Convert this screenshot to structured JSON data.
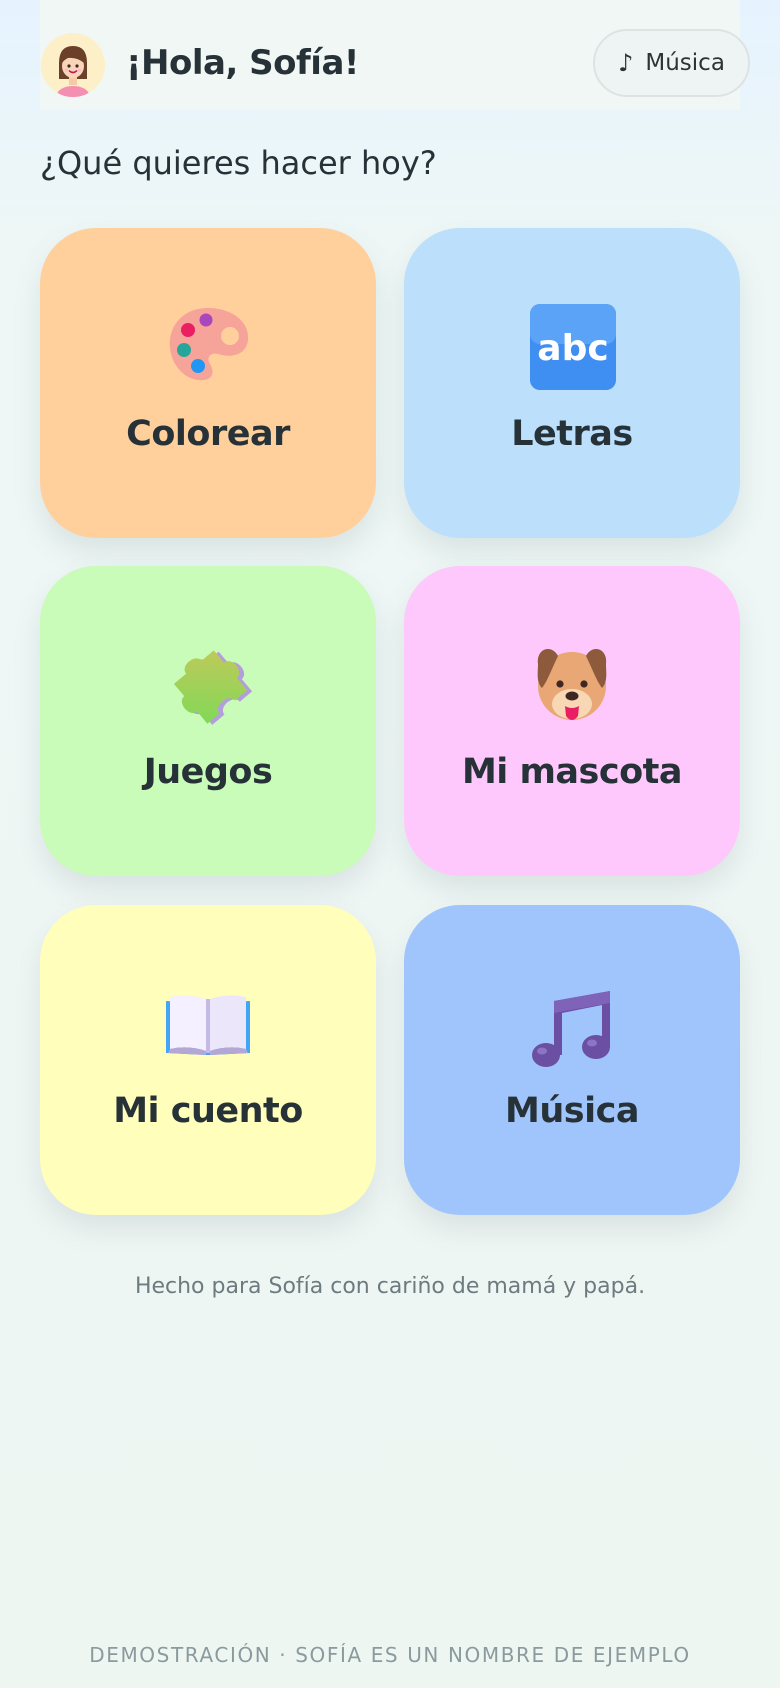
{
  "header": {
    "greeting": "¡Hola, Sofía!",
    "avatar_icon": "girl-avatar-icon",
    "music_button": {
      "icon": "music-note-icon",
      "glyph": "♪",
      "label": "Música"
    }
  },
  "subtitle": "¿Qué quieres hacer hoy?",
  "tiles": [
    {
      "label": "Colorear",
      "icon": "palette-icon",
      "color": "#ffd09c"
    },
    {
      "label": "Letras",
      "icon": "abc-icon",
      "color": "#bcdffc"
    },
    {
      "label": "Juegos",
      "icon": "puzzle-piece-icon",
      "color": "#c8fcb8"
    },
    {
      "label": "Mi mascota",
      "icon": "dog-face-icon",
      "color": "#ffc8fc"
    },
    {
      "label": "Mi cuento",
      "icon": "open-book-icon",
      "color": "#fffeba"
    },
    {
      "label": "Música",
      "icon": "musical-note-icon",
      "color": "#a0c4fc"
    }
  ],
  "footer_note": "Hecho para Sofía con cariño de mamá y papá.",
  "demo_note": "DEMOSTRACIÓN · SOFÍA ES UN NOMBRE DE EJEMPLO"
}
